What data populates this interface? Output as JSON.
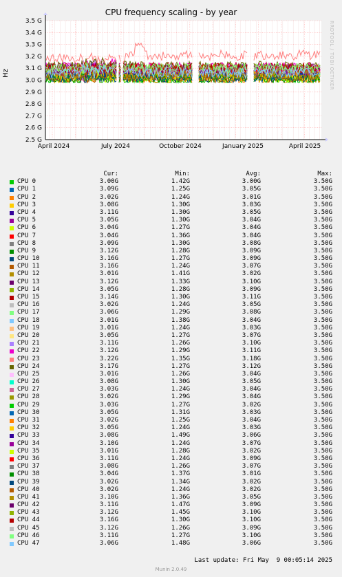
{
  "title": "CPU frequency scaling - by year",
  "watermark": "RRDTOOL / TOBI OETIKER",
  "footer": "Last update: Fri May  9 00:05:14 2025",
  "munin_version": "Munin 2.0.49",
  "legend_headers": [
    "Cur:",
    "Min:",
    "Avg:",
    "Max:"
  ],
  "chart_data": {
    "type": "line",
    "title": "CPU frequency scaling - by year",
    "ylabel": "Hz",
    "ylim": [
      2.5,
      3.5
    ],
    "y_ticks": [
      "2.5 G",
      "2.6 G",
      "2.7 G",
      "2.8 G",
      "2.9 G",
      "3.0 G",
      "3.1 G",
      "3.2 G",
      "3.3 G",
      "3.4 G",
      "3.5 G"
    ],
    "x_ticks": [
      "April 2024",
      "July 2024",
      "October 2024",
      "January 2025",
      "April 2025"
    ],
    "grid": true,
    "series_band": {
      "min": 3.0,
      "max": 3.2,
      "peak": 3.33
    },
    "series": [
      {
        "name": "CPU 0",
        "color": "#00cc00",
        "cur": "3.00G",
        "min": "1.42G",
        "avg": "3.00G",
        "max": "3.50G"
      },
      {
        "name": "CPU 1",
        "color": "#0066b3",
        "cur": "3.09G",
        "min": "1.25G",
        "avg": "3.05G",
        "max": "3.50G"
      },
      {
        "name": "CPU 2",
        "color": "#ff8000",
        "cur": "3.02G",
        "min": "1.24G",
        "avg": "3.01G",
        "max": "3.50G"
      },
      {
        "name": "CPU 3",
        "color": "#ffcc00",
        "cur": "3.08G",
        "min": "1.30G",
        "avg": "3.03G",
        "max": "3.50G"
      },
      {
        "name": "CPU 4",
        "color": "#330099",
        "cur": "3.11G",
        "min": "1.30G",
        "avg": "3.05G",
        "max": "3.50G"
      },
      {
        "name": "CPU 5",
        "color": "#990099",
        "cur": "3.05G",
        "min": "1.30G",
        "avg": "3.04G",
        "max": "3.50G"
      },
      {
        "name": "CPU 6",
        "color": "#ccff00",
        "cur": "3.04G",
        "min": "1.27G",
        "avg": "3.04G",
        "max": "3.50G"
      },
      {
        "name": "CPU 7",
        "color": "#ff0000",
        "cur": "3.04G",
        "min": "1.36G",
        "avg": "3.04G",
        "max": "3.50G"
      },
      {
        "name": "CPU 8",
        "color": "#808080",
        "cur": "3.09G",
        "min": "1.30G",
        "avg": "3.08G",
        "max": "3.50G"
      },
      {
        "name": "CPU 9",
        "color": "#008f00",
        "cur": "3.12G",
        "min": "1.28G",
        "avg": "3.09G",
        "max": "3.50G"
      },
      {
        "name": "CPU 10",
        "color": "#00487d",
        "cur": "3.16G",
        "min": "1.27G",
        "avg": "3.09G",
        "max": "3.50G"
      },
      {
        "name": "CPU 11",
        "color": "#b35a00",
        "cur": "3.16G",
        "min": "1.24G",
        "avg": "3.07G",
        "max": "3.50G"
      },
      {
        "name": "CPU 12",
        "color": "#b38f00",
        "cur": "3.01G",
        "min": "1.41G",
        "avg": "3.02G",
        "max": "3.50G"
      },
      {
        "name": "CPU 13",
        "color": "#6b006b",
        "cur": "3.12G",
        "min": "1.33G",
        "avg": "3.10G",
        "max": "3.50G"
      },
      {
        "name": "CPU 14",
        "color": "#8fb300",
        "cur": "3.05G",
        "min": "1.28G",
        "avg": "3.09G",
        "max": "3.50G"
      },
      {
        "name": "CPU 15",
        "color": "#b30000",
        "cur": "3.14G",
        "min": "1.30G",
        "avg": "3.11G",
        "max": "3.50G"
      },
      {
        "name": "CPU 16",
        "color": "#bebebe",
        "cur": "3.02G",
        "min": "1.24G",
        "avg": "3.05G",
        "max": "3.50G"
      },
      {
        "name": "CPU 17",
        "color": "#80ff80",
        "cur": "3.06G",
        "min": "1.29G",
        "avg": "3.08G",
        "max": "3.50G"
      },
      {
        "name": "CPU 18",
        "color": "#80c9ff",
        "cur": "3.01G",
        "min": "1.38G",
        "avg": "3.04G",
        "max": "3.50G"
      },
      {
        "name": "CPU 19",
        "color": "#ffc080",
        "cur": "3.01G",
        "min": "1.24G",
        "avg": "3.03G",
        "max": "3.50G"
      },
      {
        "name": "CPU 20",
        "color": "#ffe680",
        "cur": "3.05G",
        "min": "1.27G",
        "avg": "3.07G",
        "max": "3.50G"
      },
      {
        "name": "CPU 21",
        "color": "#aa80ff",
        "cur": "3.11G",
        "min": "1.26G",
        "avg": "3.10G",
        "max": "3.50G"
      },
      {
        "name": "CPU 22",
        "color": "#ee00cc",
        "cur": "3.12G",
        "min": "1.29G",
        "avg": "3.11G",
        "max": "3.50G"
      },
      {
        "name": "CPU 23",
        "color": "#ff8080",
        "cur": "3.22G",
        "min": "1.35G",
        "avg": "3.18G",
        "max": "3.50G"
      },
      {
        "name": "CPU 24",
        "color": "#666600",
        "cur": "3.17G",
        "min": "1.27G",
        "avg": "3.12G",
        "max": "3.50G"
      },
      {
        "name": "CPU 25",
        "color": "#ffbfff",
        "cur": "3.01G",
        "min": "1.26G",
        "avg": "3.04G",
        "max": "3.50G"
      },
      {
        "name": "CPU 26",
        "color": "#00ffcc",
        "cur": "3.08G",
        "min": "1.30G",
        "avg": "3.05G",
        "max": "3.50G"
      },
      {
        "name": "CPU 27",
        "color": "#cc6699",
        "cur": "3.03G",
        "min": "1.24G",
        "avg": "3.04G",
        "max": "3.50G"
      },
      {
        "name": "CPU 28",
        "color": "#999900",
        "cur": "3.02G",
        "min": "1.29G",
        "avg": "3.04G",
        "max": "3.50G"
      },
      {
        "name": "CPU 29",
        "color": "#00cc00",
        "cur": "3.03G",
        "min": "1.27G",
        "avg": "3.02G",
        "max": "3.50G"
      },
      {
        "name": "CPU 30",
        "color": "#0066b3",
        "cur": "3.05G",
        "min": "1.31G",
        "avg": "3.03G",
        "max": "3.50G"
      },
      {
        "name": "CPU 31",
        "color": "#ff8000",
        "cur": "3.02G",
        "min": "1.25G",
        "avg": "3.04G",
        "max": "3.50G"
      },
      {
        "name": "CPU 32",
        "color": "#ffcc00",
        "cur": "3.05G",
        "min": "1.24G",
        "avg": "3.03G",
        "max": "3.50G"
      },
      {
        "name": "CPU 33",
        "color": "#330099",
        "cur": "3.08G",
        "min": "1.49G",
        "avg": "3.06G",
        "max": "3.50G"
      },
      {
        "name": "CPU 34",
        "color": "#990099",
        "cur": "3.10G",
        "min": "1.24G",
        "avg": "3.07G",
        "max": "3.50G"
      },
      {
        "name": "CPU 35",
        "color": "#ccff00",
        "cur": "3.01G",
        "min": "1.28G",
        "avg": "3.02G",
        "max": "3.50G"
      },
      {
        "name": "CPU 36",
        "color": "#ff0000",
        "cur": "3.11G",
        "min": "1.24G",
        "avg": "3.09G",
        "max": "3.50G"
      },
      {
        "name": "CPU 37",
        "color": "#808080",
        "cur": "3.08G",
        "min": "1.26G",
        "avg": "3.07G",
        "max": "3.50G"
      },
      {
        "name": "CPU 38",
        "color": "#008f00",
        "cur": "3.04G",
        "min": "1.37G",
        "avg": "3.01G",
        "max": "3.50G"
      },
      {
        "name": "CPU 39",
        "color": "#00487d",
        "cur": "3.02G",
        "min": "1.34G",
        "avg": "3.02G",
        "max": "3.50G"
      },
      {
        "name": "CPU 40",
        "color": "#b35a00",
        "cur": "3.02G",
        "min": "1.24G",
        "avg": "3.02G",
        "max": "3.50G"
      },
      {
        "name": "CPU 41",
        "color": "#b38f00",
        "cur": "3.10G",
        "min": "1.36G",
        "avg": "3.05G",
        "max": "3.50G"
      },
      {
        "name": "CPU 42",
        "color": "#6b006b",
        "cur": "3.11G",
        "min": "1.47G",
        "avg": "3.09G",
        "max": "3.50G"
      },
      {
        "name": "CPU 43",
        "color": "#8fb300",
        "cur": "3.12G",
        "min": "1.45G",
        "avg": "3.10G",
        "max": "3.50G"
      },
      {
        "name": "CPU 44",
        "color": "#b30000",
        "cur": "3.16G",
        "min": "1.30G",
        "avg": "3.10G",
        "max": "3.50G"
      },
      {
        "name": "CPU 45",
        "color": "#bebebe",
        "cur": "3.12G",
        "min": "1.26G",
        "avg": "3.09G",
        "max": "3.50G"
      },
      {
        "name": "CPU 46",
        "color": "#80ff80",
        "cur": "3.11G",
        "min": "1.27G",
        "avg": "3.10G",
        "max": "3.50G"
      },
      {
        "name": "CPU 47",
        "color": "#80c9ff",
        "cur": "3.06G",
        "min": "1.48G",
        "avg": "3.06G",
        "max": "3.50G"
      }
    ]
  }
}
